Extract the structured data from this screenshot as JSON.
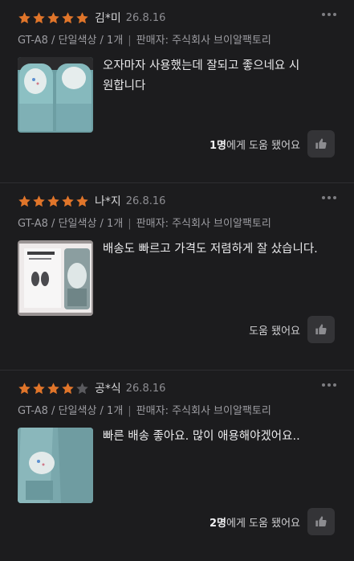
{
  "colors": {
    "star_filled": "#e0752a",
    "star_empty": "#5a5a5e",
    "background": "#1c1c1e"
  },
  "reviews": [
    {
      "rating": 5,
      "reviewer": "김*미",
      "date": "26.8.16",
      "option": "GT-A8 / 단일색상 / 1개",
      "seller": "판매자: 주식회사 브이알팩토리",
      "content": "오자마자 사용했는데 잘되고 좋으네요 시원합니다",
      "helpful_count": "1명",
      "helpful_suffix": "에게 도움 됐어요"
    },
    {
      "rating": 5,
      "reviewer": "나*지",
      "date": "26.8.16",
      "option": "GT-A8 / 단일색상 / 1개",
      "seller": "판매자: 주식회사 브이알팩토리",
      "content": "배송도 빠르고 가격도 저렴하게 잘 샀습니다.",
      "helpful_count": "",
      "helpful_suffix": "도움 됐어요"
    },
    {
      "rating": 4,
      "reviewer": "공*식",
      "date": "26.8.16",
      "option": "GT-A8 / 단일색상 / 1개",
      "seller": "판매자: 주식회사 브이알팩토리",
      "content": "빠른 배송 좋아요. 많이 애용해야겠어요..",
      "helpful_count": "2명",
      "helpful_suffix": "에게 도움 됐어요"
    }
  ],
  "icons": {
    "more": "more-dots-icon",
    "like": "thumbs-up-icon",
    "star": "star-icon"
  }
}
